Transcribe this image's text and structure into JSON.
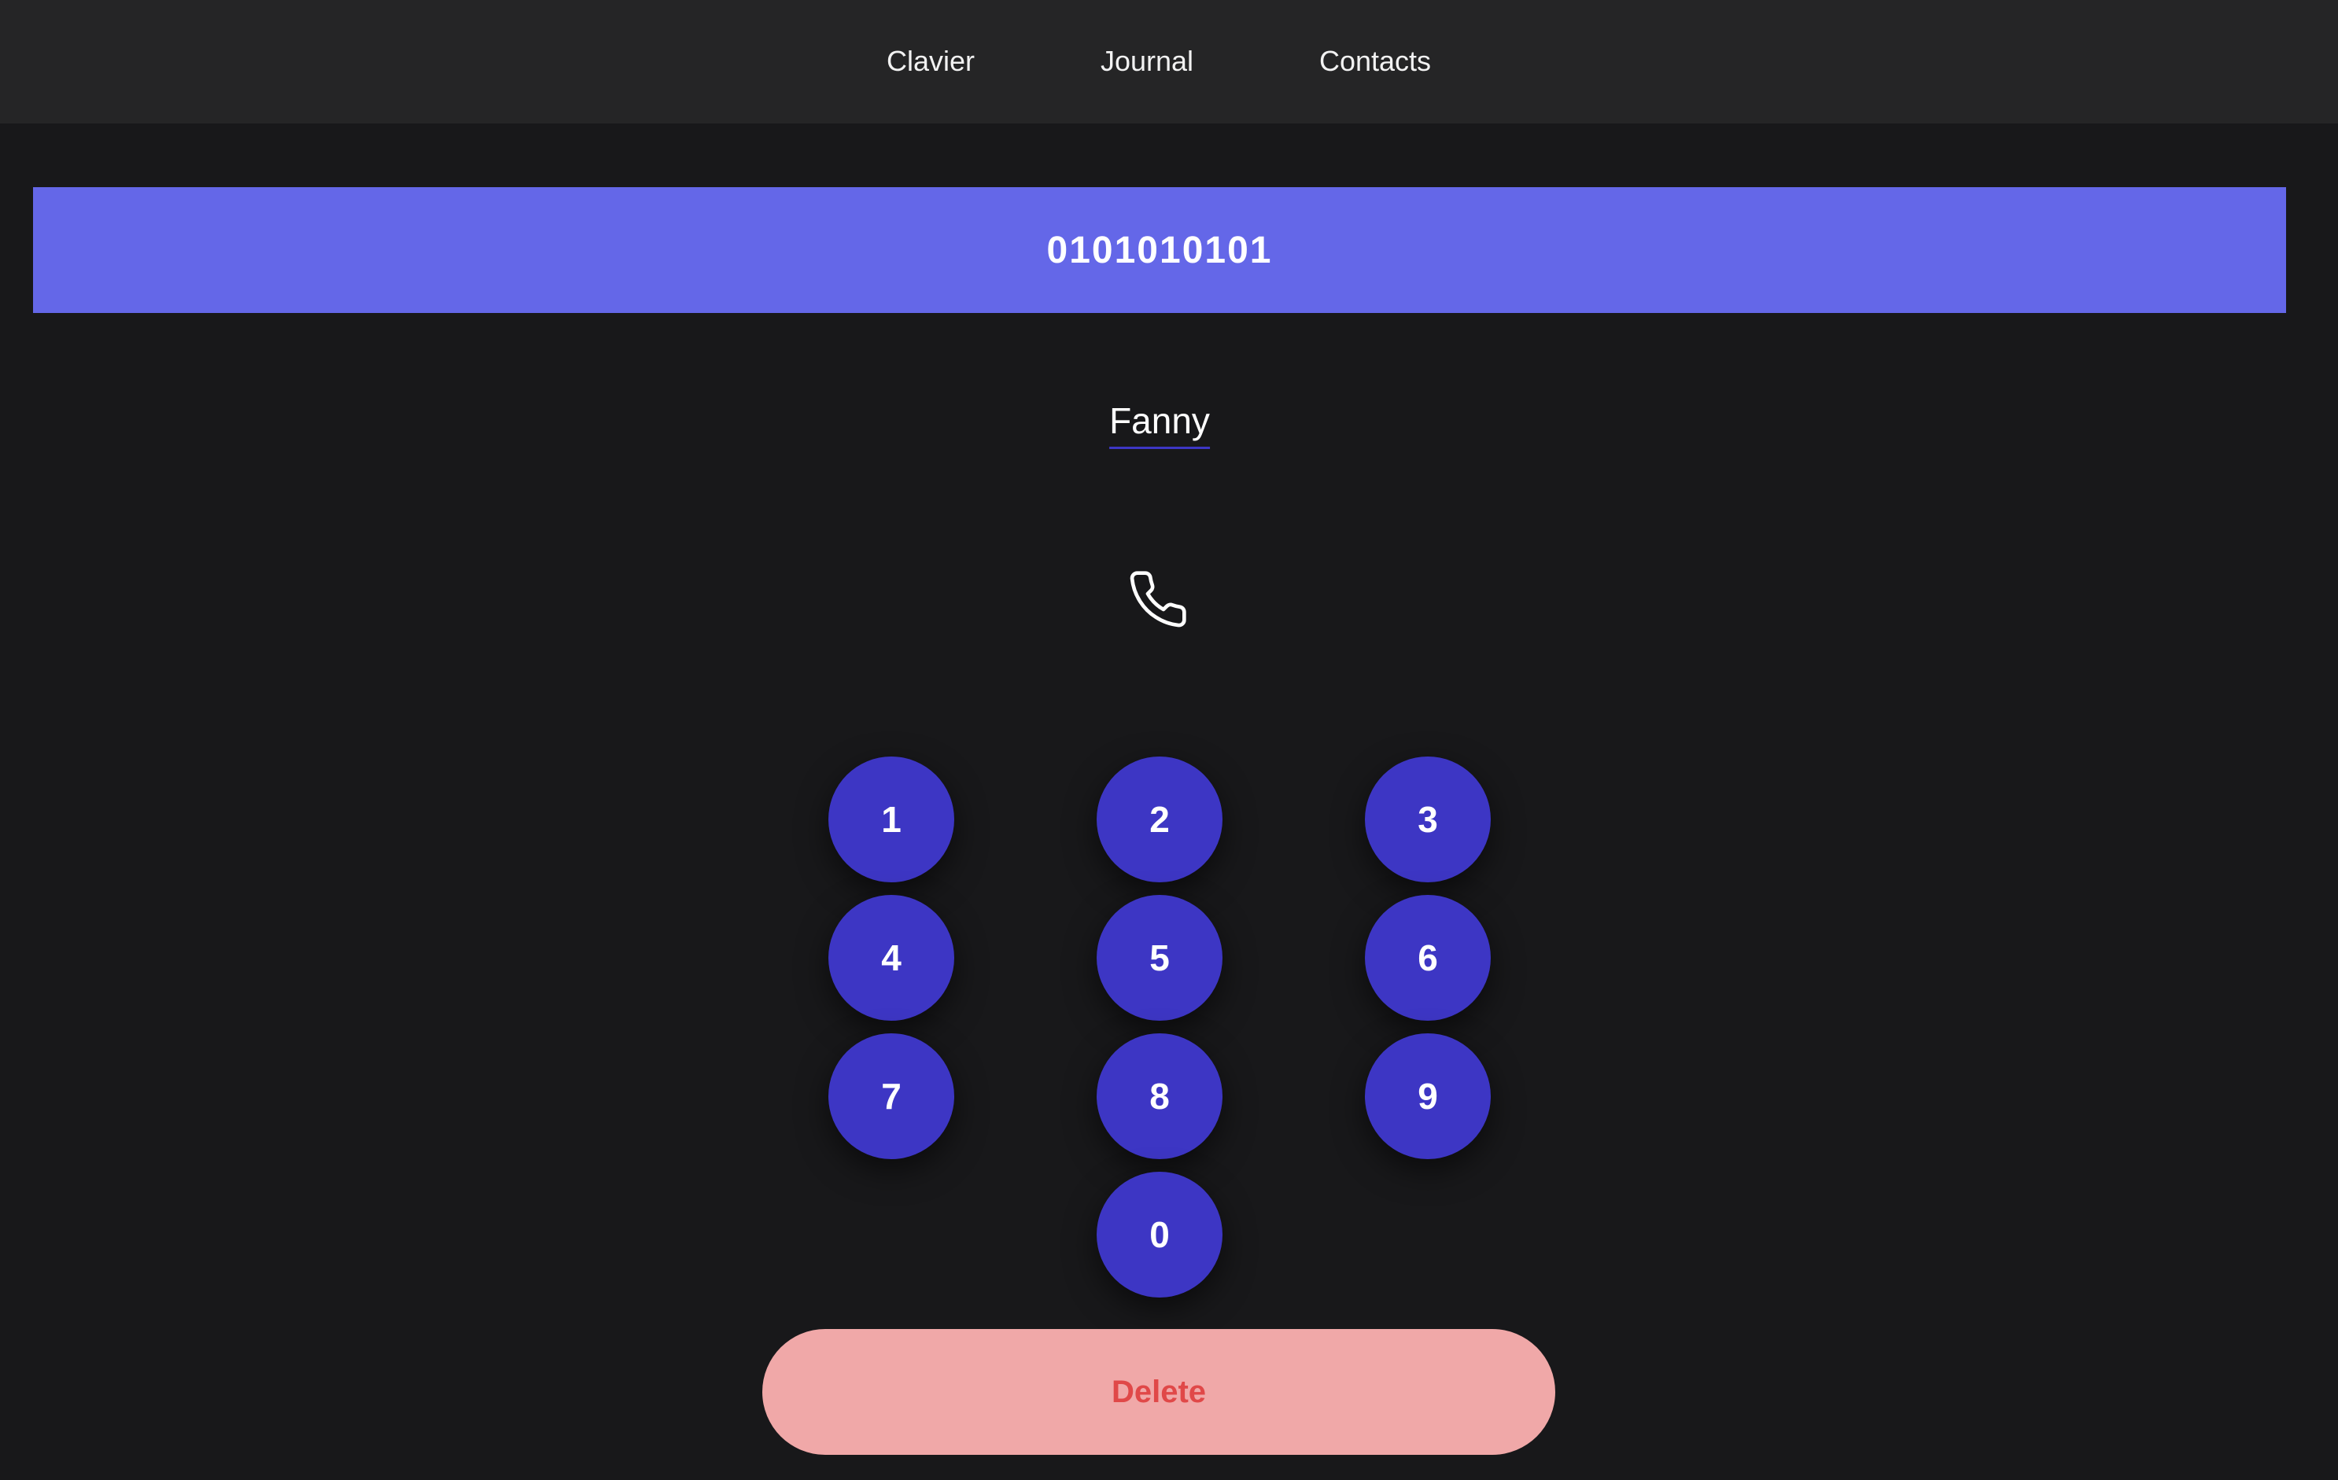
{
  "nav": {
    "tabs": [
      {
        "label": "Clavier"
      },
      {
        "label": "Journal"
      },
      {
        "label": "Contacts"
      }
    ]
  },
  "display": {
    "number": "0101010101"
  },
  "contact": {
    "name": "Fanny"
  },
  "call": {
    "icon": "phone-icon"
  },
  "keypad": {
    "keys": [
      "1",
      "2",
      "3",
      "4",
      "5",
      "6",
      "7",
      "8",
      "9",
      "0"
    ]
  },
  "actions": {
    "delete_label": "Delete"
  },
  "colors": {
    "background": "#18181a",
    "topbar": "#252526",
    "display_bar": "#6467e8",
    "key": "#3d36c4",
    "delete_bg": "#f0a8a8",
    "delete_text": "#e04848"
  }
}
